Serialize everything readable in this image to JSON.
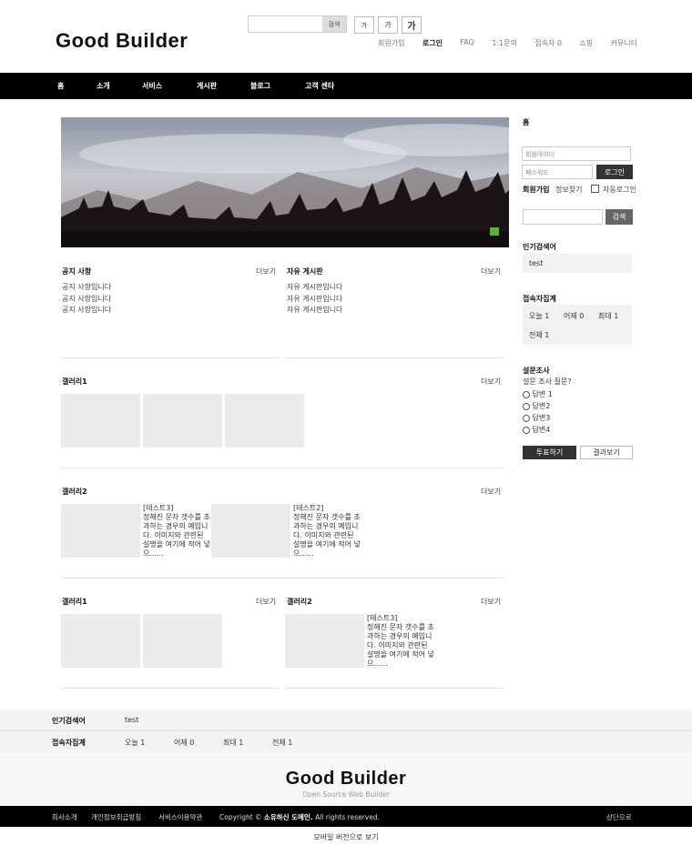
{
  "header": {
    "logo": "Good Builder",
    "search": {
      "placeholder": "",
      "button": "검색"
    },
    "font_sizes": [
      "가",
      "가",
      "가"
    ],
    "links": [
      "회원가입",
      "로그인",
      "FAQ",
      "1:1문의",
      "접속자 0",
      "쇼핑",
      "커뮤니티"
    ]
  },
  "nav": [
    "홈",
    "소개",
    "서비스",
    "게시판",
    "블로그",
    "고객 센타"
  ],
  "notice": {
    "title": "공지 사항",
    "more": "더보기",
    "items": [
      "공지 사항입니다",
      "공지 사항입니다",
      "공지 사항입니다"
    ]
  },
  "board": {
    "title": "자유 게시판",
    "more": "더보기",
    "items": [
      "자유 게시판입니다",
      "자유 게시판입니다",
      "자유 게시판입니다"
    ]
  },
  "gallery1": {
    "title": "갤러리1",
    "more": "더보기"
  },
  "gallery2": {
    "title": "갤러리2",
    "more": "더보기",
    "items": [
      {
        "title": "[테스트3]",
        "text": "정해진 문자 갯수를 초과하는 경우의 예입니다. 이미지와 관련된 설명을 여기에 적어 넣으......"
      },
      {
        "title": "[테스트2]",
        "text": "정해진 문자 갯수를 초과하는 경우의 예입니다. 이미지와 관련된 설명을 여기에 적어 넣으......"
      }
    ]
  },
  "bottom_left": {
    "title": "갤러리1",
    "more": "더보기"
  },
  "bottom_right": {
    "title": "갤러리2",
    "more": "더보기",
    "item": {
      "title": "[테스트3]",
      "text": "정해진 문자 갯수를 초과하는 경우의 예입니다. 이미지와 관련된 설명을 여기에 적어 넣으......"
    }
  },
  "sidebar": {
    "home": "홈",
    "login": {
      "id_placeholder": "회원아이디",
      "pw_placeholder": "패스워드",
      "button": "로그인",
      "join": "회원가입",
      "find": "정보찾기",
      "auto": "자동로그인"
    },
    "search_button": "검색",
    "popular": {
      "title": "인기검색어",
      "items": [
        "test"
      ]
    },
    "visitors": {
      "title": "접속자집계",
      "today": "오늘 1",
      "yesterday": "어제 0",
      "max": "최대 1",
      "total": "전체 1"
    },
    "poll": {
      "title": "설문조사",
      "question": "설문 조사 질문?",
      "options": [
        "답변 1",
        "답변2",
        "답변3",
        "답변4"
      ],
      "vote": "투표하기",
      "result": "결과보기"
    }
  },
  "footer": {
    "popular_label": "인기검색어",
    "popular_value": "test",
    "visitors_label": "접속자집계",
    "visitors": [
      "오늘 1",
      "어제 0",
      "최대 1",
      "전체 1"
    ],
    "logo": "Good Builder",
    "sub": "Open Source Web Builder",
    "links": [
      "회사소개",
      "개인정보취급방침",
      "서비스이용약관"
    ],
    "copyright_prefix": "Copyright ©",
    "copyright_name": "소유하신 도메인.",
    "copyright_suffix": "All rights reserved.",
    "top": "상단으로",
    "mobile": "모바일 버전으로 보기"
  }
}
